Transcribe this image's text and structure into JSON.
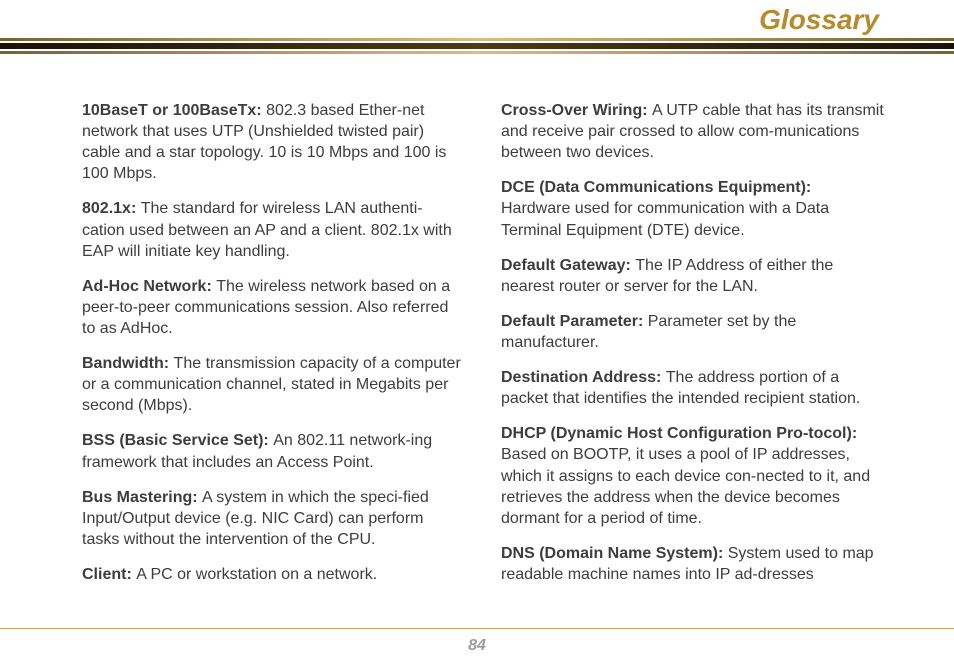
{
  "header": {
    "title": "Glossary"
  },
  "page_number": "84",
  "left": [
    {
      "term": "10BaseT or 100BaseTx:  ",
      "def": "802.3 based Ether-net network that uses UTP (Unshielded twisted pair) cable and a star topology.  10 is 10 Mbps and 100 is 100 Mbps."
    },
    {
      "term": "802.1x: ",
      "def": "The standard for wireless LAN authenti-cation used between an AP and a client.  802.1x with EAP will initiate key handling."
    },
    {
      "term": "Ad-Hoc Network: ",
      "def": "The wireless network based on a peer-to-peer communications session.  Also referred to as AdHoc."
    },
    {
      "term": "Bandwidth:  ",
      "def": "The transmission capacity of a computer or a communication channel, stated in Megabits per second (Mbps)."
    },
    {
      "term": "BSS (Basic Service Set):  ",
      "def": "An 802.11 network-ing framework that includes an Access Point."
    },
    {
      "term": "Bus Mastering:  ",
      "def": "A system in which the speci-ﬁed Input/Output device (e.g. NIC Card) can perform tasks without the intervention of the CPU."
    },
    {
      "term": "Client:  ",
      "def": "A PC or workstation on a network."
    }
  ],
  "right": [
    {
      "term": "Cross-Over Wiring: ",
      "def": "A UTP cable that has its transmit and receive pair crossed to allow com-munications between two devices."
    },
    {
      "term": "DCE (Data Communications Equipment): ",
      "def": "Hardware used for communication with a Data Terminal Equipment (DTE) device."
    },
    {
      "term": "Default Gateway: ",
      "def": "The IP Address of either the nearest router or server for the LAN."
    },
    {
      "term": "Default Parameter: ",
      "def": "Parameter set by the manufacturer."
    },
    {
      "term": "Destination Address: ",
      "def": "The address portion of a packet that identiﬁes the intended recipient station."
    },
    {
      "term": "DHCP (Dynamic Host Conﬁguration Pro-tocol): ",
      "def": "Based on BOOTP, it uses a pool of IP addresses, which it assigns to each device con-nected to it, and retrieves the address when the device becomes dormant for a period of time."
    },
    {
      "term": "DNS (Domain Name System):  ",
      "def": "System used to map readable machine names into IP ad-dresses"
    }
  ]
}
